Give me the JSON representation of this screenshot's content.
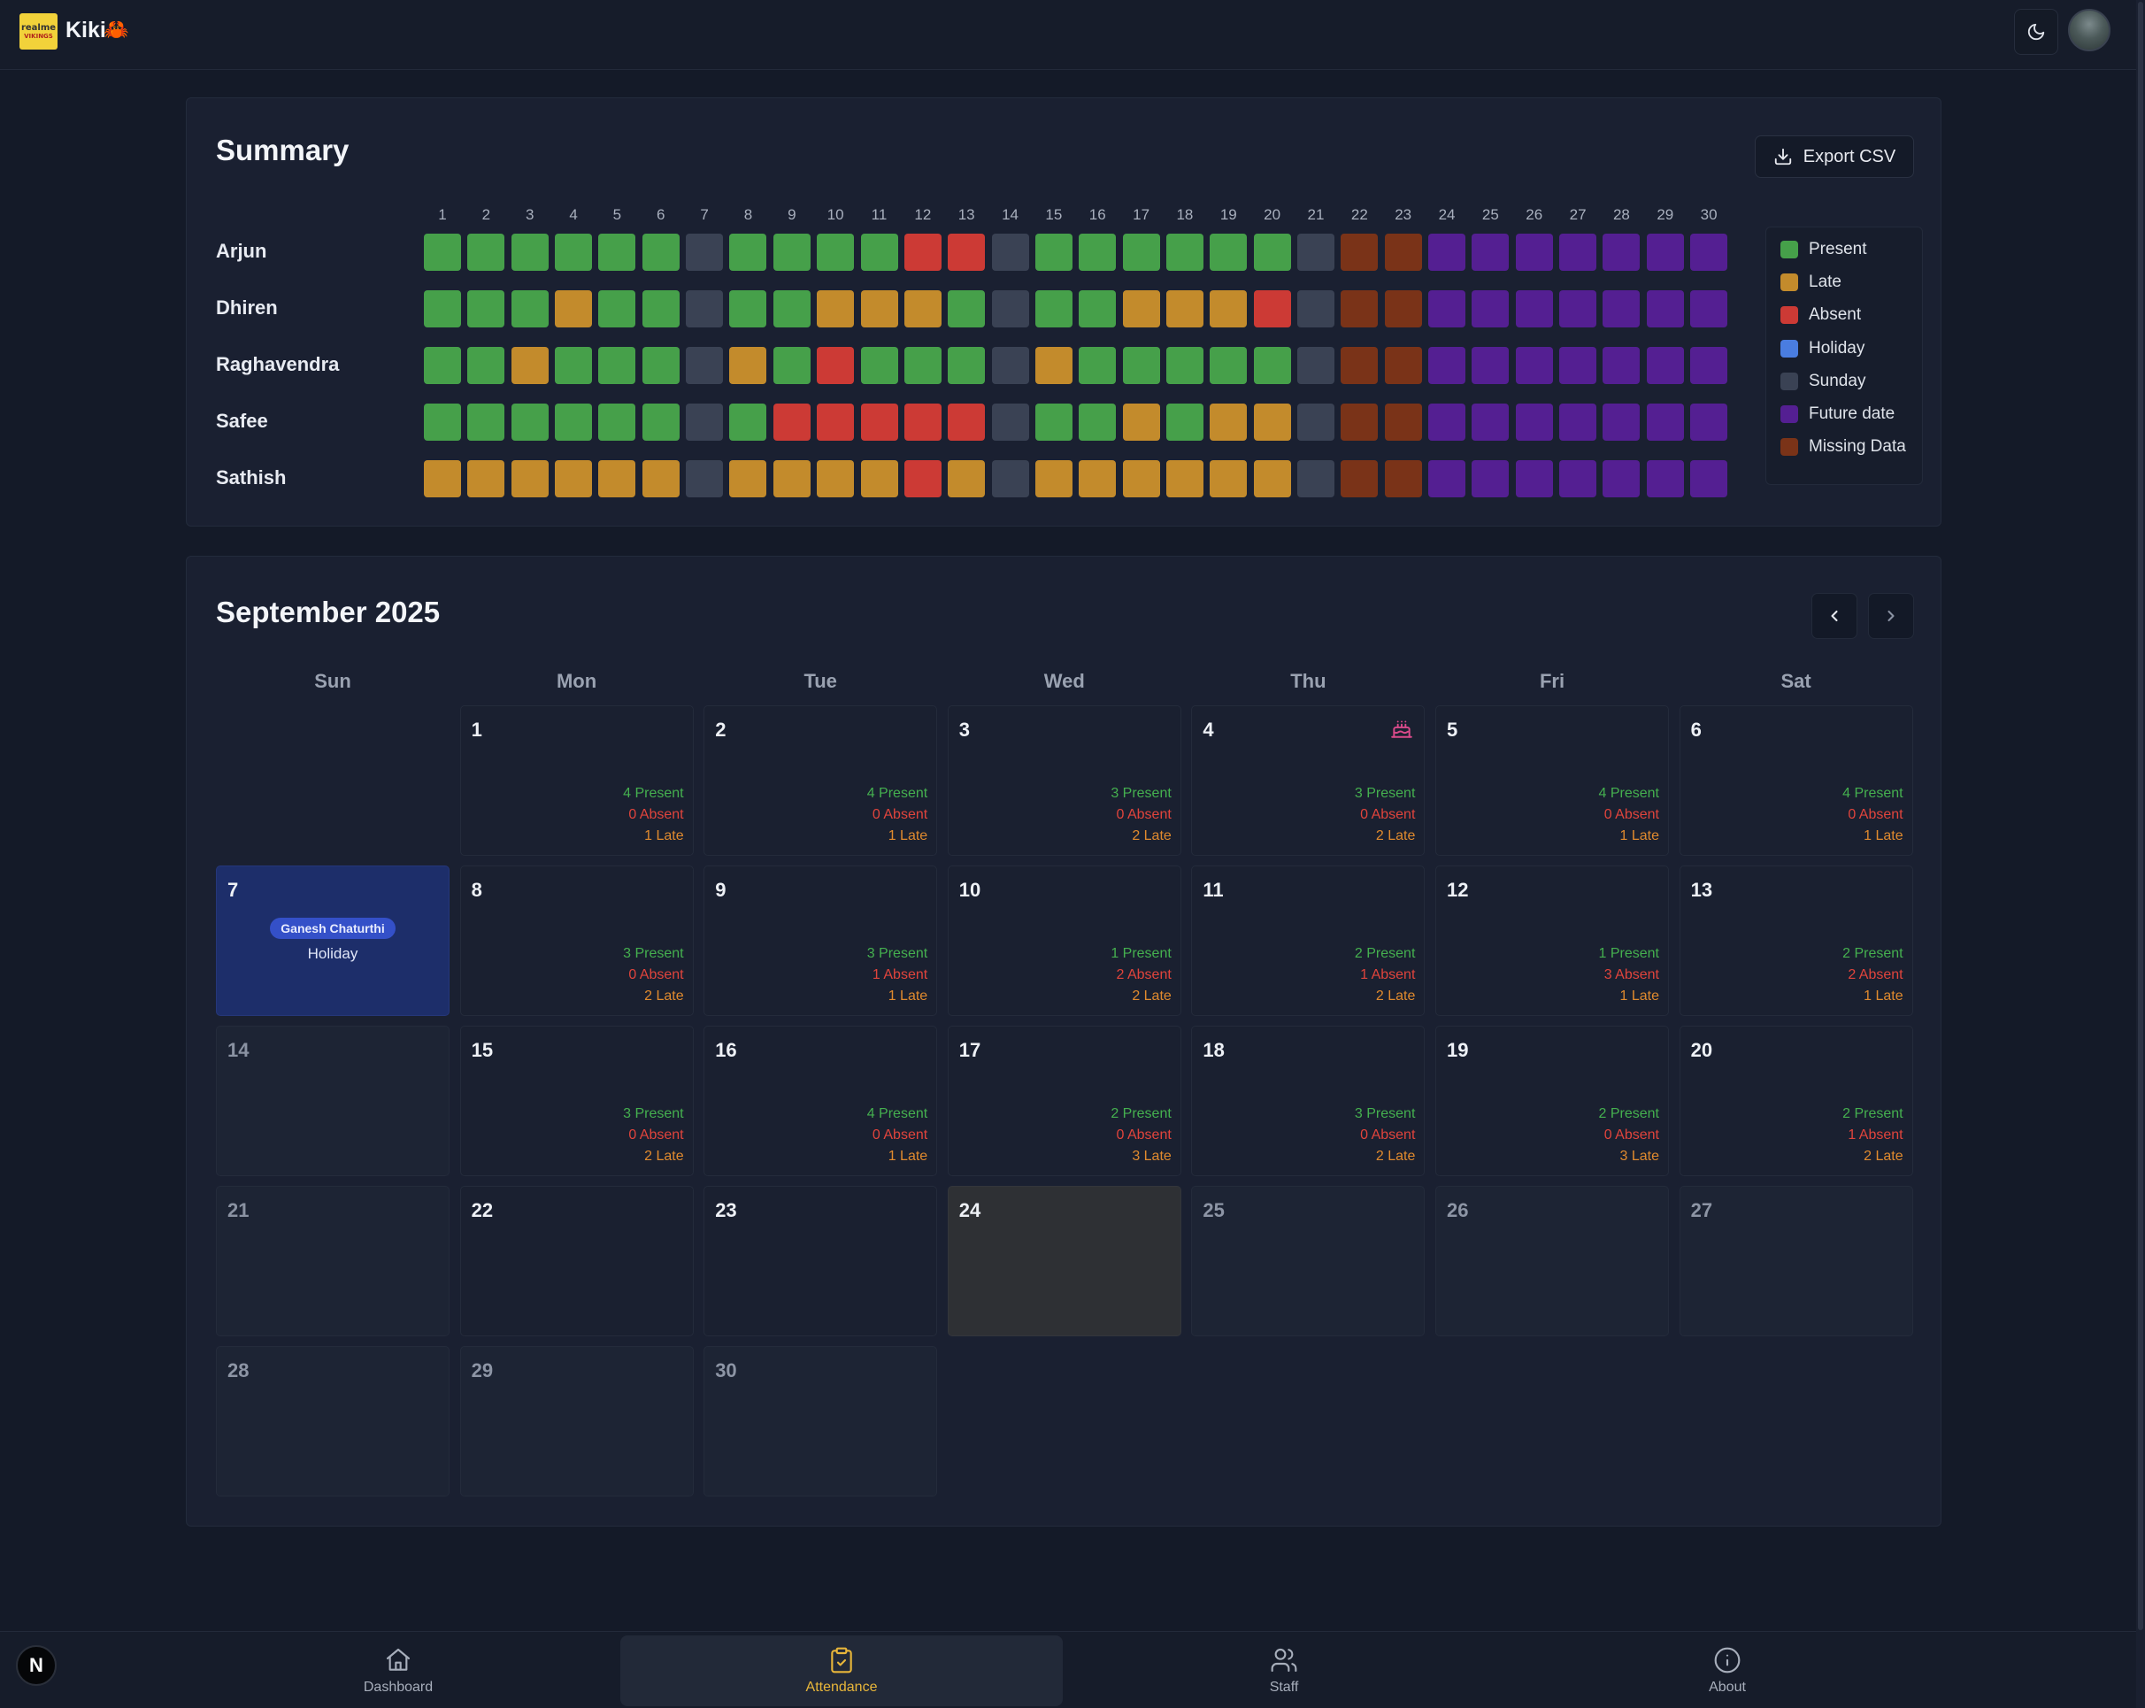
{
  "app": {
    "title": "Kiki",
    "emoji": "🦀",
    "logo_line1": "realme",
    "logo_line2": "VIKINGS"
  },
  "colors": {
    "present": "#46a04a",
    "late": "#c38b2c",
    "absent": "#cc3a35",
    "holiday": "#4a7de0",
    "sunday": "#3a4254",
    "future": "#541f92",
    "missing": "#7a3318",
    "accent": "#e8b63a"
  },
  "summary": {
    "title": "Summary",
    "export_label": "Export CSV",
    "days": [
      "1",
      "2",
      "3",
      "4",
      "5",
      "6",
      "7",
      "8",
      "9",
      "10",
      "11",
      "12",
      "13",
      "14",
      "15",
      "16",
      "17",
      "18",
      "19",
      "20",
      "21",
      "22",
      "23",
      "24",
      "25",
      "26",
      "27",
      "28",
      "29",
      "30"
    ],
    "employees": [
      {
        "name": "Arjun",
        "statuses": "PPPPPPSPPPPAASPPPPPPSMMFFFFFFF"
      },
      {
        "name": "Dhiren",
        "statuses": "PPPLPPSPPLLLPSPPLLLASMMFFFFFFF"
      },
      {
        "name": "Raghavendra",
        "statuses": "PPLPPPSLPAPPPSLPPPPPSMMFFFFFFF"
      },
      {
        "name": "Safee",
        "statuses": "PPPPPPSPAAAAASPPLPLLSMMFFFFFFF"
      },
      {
        "name": "Sathish",
        "statuses": "LLLLLLSLLLLALSLLLLLLSMMFFFFFFF"
      }
    ],
    "legend": [
      {
        "key": "P",
        "label": "Present"
      },
      {
        "key": "L",
        "label": "Late"
      },
      {
        "key": "A",
        "label": "Absent"
      },
      {
        "key": "H",
        "label": "Holiday"
      },
      {
        "key": "S",
        "label": "Sunday"
      },
      {
        "key": "F",
        "label": "Future date"
      },
      {
        "key": "M",
        "label": "Missing Data"
      }
    ]
  },
  "calendar": {
    "title": "September 2025",
    "prev_icon": "chevron-left-icon",
    "next_icon": "chevron-right-icon",
    "weekdays": [
      "Sun",
      "Mon",
      "Tue",
      "Wed",
      "Thu",
      "Fri",
      "Sat"
    ],
    "first_weekday_index": 1,
    "today": 24,
    "days": [
      {
        "d": "1",
        "present": "4 Present",
        "absent": "0 Absent",
        "late": "1 Late"
      },
      {
        "d": "2",
        "present": "4 Present",
        "absent": "0 Absent",
        "late": "1 Late"
      },
      {
        "d": "3",
        "present": "3 Present",
        "absent": "0 Absent",
        "late": "2 Late"
      },
      {
        "d": "4",
        "present": "3 Present",
        "absent": "0 Absent",
        "late": "2 Late",
        "icon": "birthday-cake-icon"
      },
      {
        "d": "5",
        "present": "4 Present",
        "absent": "0 Absent",
        "late": "1 Late"
      },
      {
        "d": "6",
        "present": "4 Present",
        "absent": "0 Absent",
        "late": "1 Late"
      },
      {
        "d": "7",
        "holiday_name": "Ganesh Chaturthi",
        "holiday_label": "Holiday"
      },
      {
        "d": "8",
        "present": "3 Present",
        "absent": "0 Absent",
        "late": "2 Late"
      },
      {
        "d": "9",
        "present": "3 Present",
        "absent": "1 Absent",
        "late": "1 Late"
      },
      {
        "d": "10",
        "present": "1 Present",
        "absent": "2 Absent",
        "late": "2 Late"
      },
      {
        "d": "11",
        "present": "2 Present",
        "absent": "1 Absent",
        "late": "2 Late"
      },
      {
        "d": "12",
        "present": "1 Present",
        "absent": "3 Absent",
        "late": "1 Late"
      },
      {
        "d": "13",
        "present": "2 Present",
        "absent": "2 Absent",
        "late": "1 Late"
      },
      {
        "d": "14",
        "sunday": true
      },
      {
        "d": "15",
        "present": "3 Present",
        "absent": "0 Absent",
        "late": "2 Late"
      },
      {
        "d": "16",
        "present": "4 Present",
        "absent": "0 Absent",
        "late": "1 Late"
      },
      {
        "d": "17",
        "present": "2 Present",
        "absent": "0 Absent",
        "late": "3 Late"
      },
      {
        "d": "18",
        "present": "3 Present",
        "absent": "0 Absent",
        "late": "2 Late"
      },
      {
        "d": "19",
        "present": "2 Present",
        "absent": "0 Absent",
        "late": "3 Late"
      },
      {
        "d": "20",
        "present": "2 Present",
        "absent": "1 Absent",
        "late": "2 Late"
      },
      {
        "d": "21",
        "sunday": true
      },
      {
        "d": "22",
        "blank": true
      },
      {
        "d": "23",
        "blank": true
      },
      {
        "d": "24",
        "blank": true,
        "today": true
      },
      {
        "d": "25",
        "future": true
      },
      {
        "d": "26",
        "future": true
      },
      {
        "d": "27",
        "future": true
      },
      {
        "d": "28",
        "future": true
      },
      {
        "d": "29",
        "future": true
      },
      {
        "d": "30",
        "future": true
      }
    ]
  },
  "bottom_nav": [
    {
      "label": "Dashboard",
      "icon": "home-icon",
      "active": false
    },
    {
      "label": "Attendance",
      "icon": "clipboard-check-icon",
      "active": true
    },
    {
      "label": "Staff",
      "icon": "users-icon",
      "active": false
    },
    {
      "label": "About",
      "icon": "info-icon",
      "active": false
    }
  ],
  "n_badge": "N"
}
